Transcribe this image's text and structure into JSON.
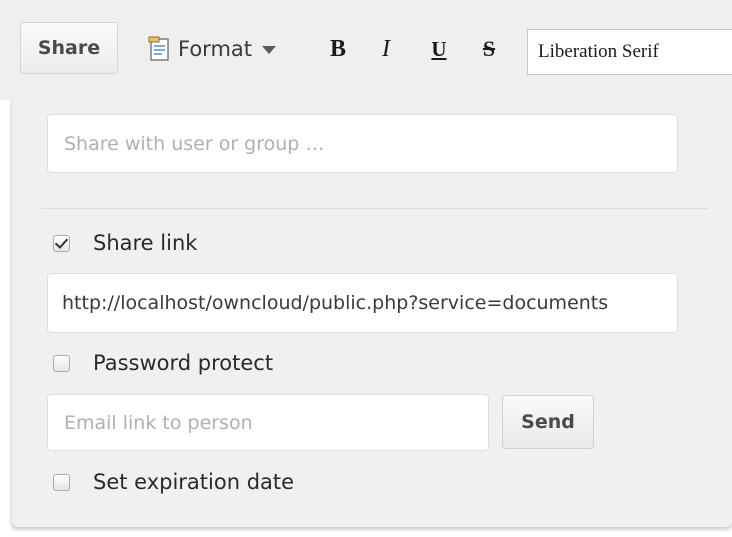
{
  "toolbar": {
    "share_label": "Share",
    "format_icon": "document-format-icon",
    "format_label": "Format",
    "bold_label": "B",
    "italic_label": "I",
    "underline_label": "U",
    "strike_label": "S",
    "font_family_value": "Liberation Serif"
  },
  "share_panel": {
    "share_with_placeholder": "Share with user or group …",
    "share_link": {
      "label": "Share link",
      "checked": true,
      "url_value": "http://localhost/owncloud/public.php?service=documents"
    },
    "password_protect": {
      "label": "Password protect",
      "checked": false
    },
    "email": {
      "placeholder": "Email link to person",
      "send_label": "Send"
    },
    "expiration": {
      "label": "Set expiration date",
      "checked": false
    }
  }
}
